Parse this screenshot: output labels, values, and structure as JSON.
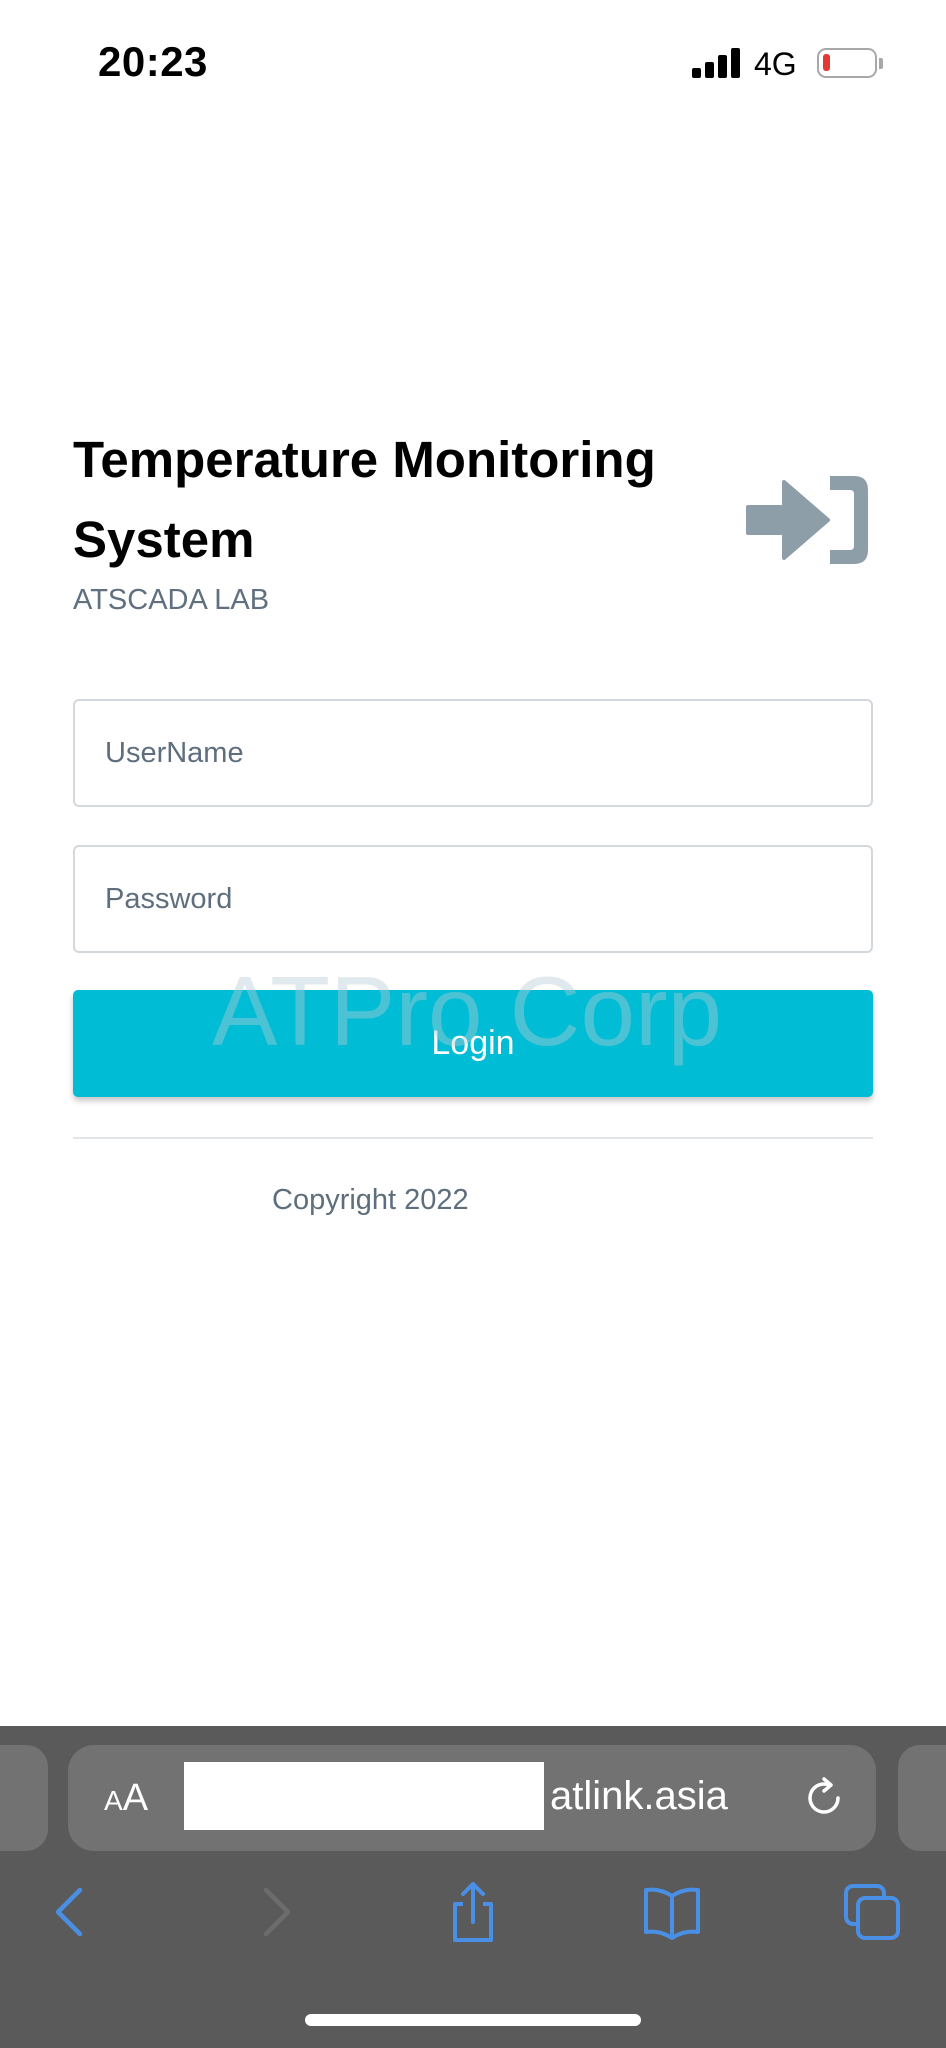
{
  "status_bar": {
    "time": "20:23",
    "network": "4G"
  },
  "login": {
    "title": "Temperature Monitoring System",
    "subtitle": "ATSCADA LAB",
    "username_placeholder": "UserName",
    "password_placeholder": "Password",
    "login_label": "Login",
    "watermark": "ATPro Corp",
    "copyright": "Copyright 2022"
  },
  "browser": {
    "aa_small": "A",
    "aa_large": "A",
    "url": "atlink.asia"
  },
  "colors": {
    "accent": "#00bcd4",
    "icon_gray": "#8e9ea8",
    "browser_blue": "#4a8fe6",
    "battery_low": "#e53935"
  },
  "icons": {
    "login": "sign-in-icon",
    "reload": "reload-icon",
    "back": "chevron-left-icon",
    "forward": "chevron-right-icon",
    "share": "share-icon",
    "bookmarks": "book-icon",
    "tabs": "tabs-icon"
  }
}
